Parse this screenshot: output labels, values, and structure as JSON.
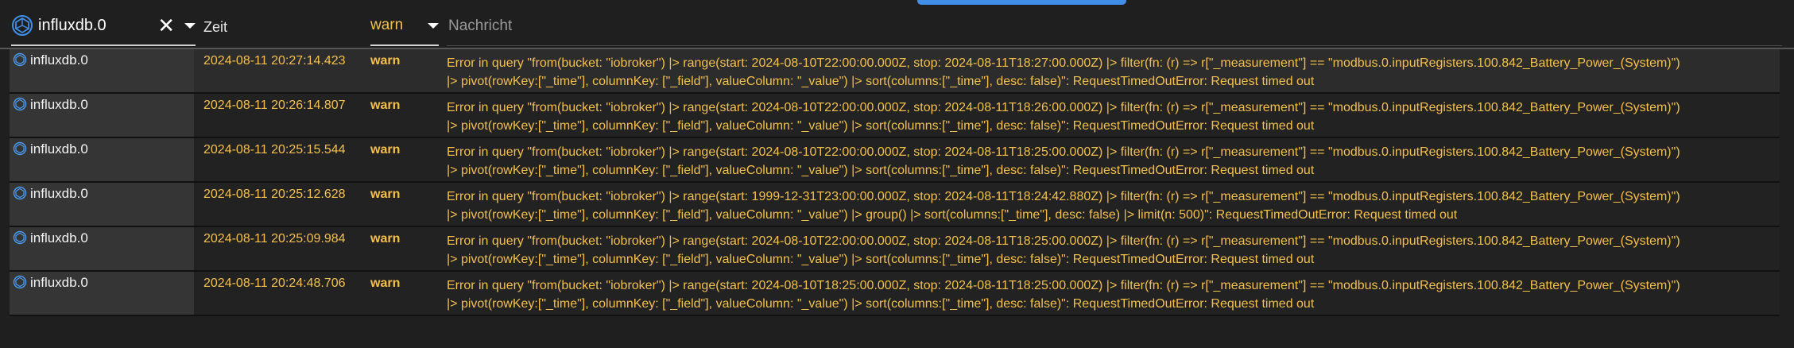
{
  "colors": {
    "background": "#1f1f1f",
    "accent": "#3f8fe8",
    "warn": "#f3c04c",
    "text": "#ffffff"
  },
  "filters": {
    "source_value": "influxdb.0",
    "source_icon": "instance-icon",
    "time_header": "Zeit",
    "level_value": "warn",
    "message_placeholder": "Nachricht"
  },
  "log": {
    "rows": [
      {
        "source": "influxdb.0",
        "time": "2024-08-11 20:27:14.423",
        "level": "warn",
        "message_line1": "Error in query \"from(bucket: \"iobroker\") |> range(start: 2024-08-10T22:00:00.000Z, stop: 2024-08-11T18:27:00.000Z) |> filter(fn: (r) => r[\"_measurement\"] == \"modbus.0.inputRegisters.100.842_Battery_Power_(System)\")",
        "message_line2": "|> pivot(rowKey:[\"_time\"], columnKey: [\"_field\"], valueColumn: \"_value\") |> sort(columns:[\"_time\"], desc: false)\": RequestTimedOutError: Request timed out"
      },
      {
        "source": "influxdb.0",
        "time": "2024-08-11 20:26:14.807",
        "level": "warn",
        "message_line1": "Error in query \"from(bucket: \"iobroker\") |> range(start: 2024-08-10T22:00:00.000Z, stop: 2024-08-11T18:26:00.000Z) |> filter(fn: (r) => r[\"_measurement\"] == \"modbus.0.inputRegisters.100.842_Battery_Power_(System)\")",
        "message_line2": "|> pivot(rowKey:[\"_time\"], columnKey: [\"_field\"], valueColumn: \"_value\") |> sort(columns:[\"_time\"], desc: false)\": RequestTimedOutError: Request timed out"
      },
      {
        "source": "influxdb.0",
        "time": "2024-08-11 20:25:15.544",
        "level": "warn",
        "message_line1": "Error in query \"from(bucket: \"iobroker\") |> range(start: 2024-08-10T22:00:00.000Z, stop: 2024-08-11T18:25:00.000Z) |> filter(fn: (r) => r[\"_measurement\"] == \"modbus.0.inputRegisters.100.842_Battery_Power_(System)\")",
        "message_line2": "|> pivot(rowKey:[\"_time\"], columnKey: [\"_field\"], valueColumn: \"_value\") |> sort(columns:[\"_time\"], desc: false)\": RequestTimedOutError: Request timed out"
      },
      {
        "source": "influxdb.0",
        "time": "2024-08-11 20:25:12.628",
        "level": "warn",
        "message_line1": "Error in query \"from(bucket: \"iobroker\") |> range(start: 1999-12-31T23:00:00.000Z, stop: 2024-08-11T18:24:42.880Z) |> filter(fn: (r) => r[\"_measurement\"] == \"modbus.0.inputRegisters.100.842_Battery_Power_(System)\")",
        "message_line2": "|> pivot(rowKey:[\"_time\"], columnKey: [\"_field\"], valueColumn: \"_value\") |> group() |> sort(columns:[\"_time\"], desc: false) |> limit(n: 500)\": RequestTimedOutError: Request timed out"
      },
      {
        "source": "influxdb.0",
        "time": "2024-08-11 20:25:09.984",
        "level": "warn",
        "message_line1": "Error in query \"from(bucket: \"iobroker\") |> range(start: 2024-08-10T22:00:00.000Z, stop: 2024-08-11T18:25:00.000Z) |> filter(fn: (r) => r[\"_measurement\"] == \"modbus.0.inputRegisters.100.842_Battery_Power_(System)\")",
        "message_line2": "|> pivot(rowKey:[\"_time\"], columnKey: [\"_field\"], valueColumn: \"_value\") |> sort(columns:[\"_time\"], desc: false)\": RequestTimedOutError: Request timed out"
      },
      {
        "source": "influxdb.0",
        "time": "2024-08-11 20:24:48.706",
        "level": "warn",
        "message_line1": "Error in query \"from(bucket: \"iobroker\") |> range(start: 2024-08-10T18:25:00.000Z, stop: 2024-08-11T18:25:00.000Z) |> filter(fn: (r) => r[\"_measurement\"] == \"modbus.0.inputRegisters.100.842_Battery_Power_(System)\")",
        "message_line2": "|> pivot(rowKey:[\"_time\"], columnKey: [\"_field\"], valueColumn: \"_value\") |> sort(columns:[\"_time\"], desc: false)\": RequestTimedOutError: Request timed out"
      }
    ]
  }
}
